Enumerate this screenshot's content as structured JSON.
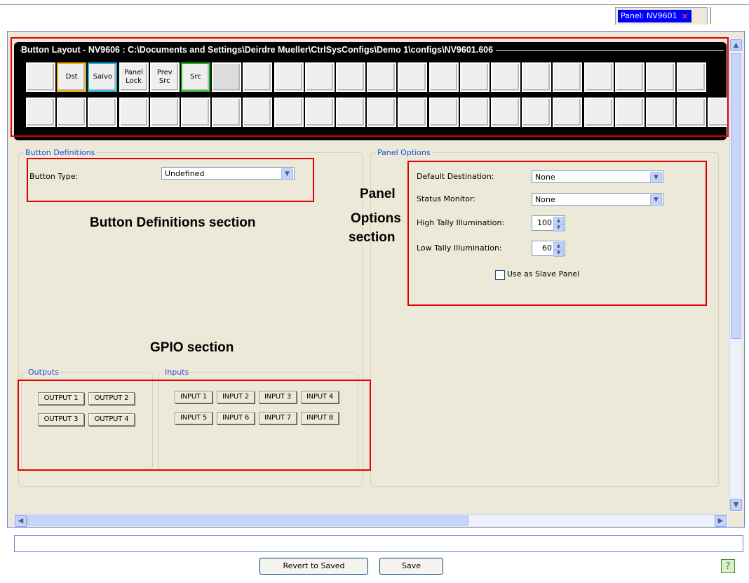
{
  "tab": {
    "label": "Panel: NV9601",
    "close": "×"
  },
  "button_layout": {
    "title": "Button Layout - NV9606 : C:\\Documents and Settings\\Deirdre Mueller\\CtrlSysConfigs\\Demo 1\\configs\\NV9601.606",
    "row1": [
      "",
      "Dst",
      "Salvo",
      "Panel\nLock",
      "Prev\nSrc",
      "Src",
      "",
      "",
      "",
      "",
      "",
      "",
      "",
      "",
      "",
      "",
      "",
      "",
      "",
      "",
      "",
      ""
    ],
    "row2": [
      "",
      "",
      "",
      "",
      "",
      "",
      "",
      "",
      "",
      "",
      "",
      "",
      "",
      "",
      "",
      "",
      "",
      "",
      "",
      "",
      "",
      "",
      ""
    ],
    "colors": {
      "dst": "#f2b400",
      "salvo": "#11b5d6",
      "src": "#18b418"
    }
  },
  "button_definitions": {
    "legend": "Button Definitions",
    "button_type_label": "Button Type:",
    "button_type_value": "Undefined"
  },
  "panel_options": {
    "legend": "Panel Options",
    "default_destination_label": "Default Destination:",
    "default_destination_value": "None",
    "status_monitor_label": "Status Monitor:",
    "status_monitor_value": "None",
    "high_tally_label": "High Tally Illumination:",
    "high_tally_value": "100",
    "low_tally_label": "Low Tally Illumination:",
    "low_tally_value": "60",
    "slave_label": "Use as Slave Panel"
  },
  "outputs": {
    "legend": "Outputs",
    "items": [
      "OUTPUT 1",
      "OUTPUT 2",
      "OUTPUT 3",
      "OUTPUT 4"
    ]
  },
  "inputs": {
    "legend": "Inputs",
    "items": [
      "INPUT 1",
      "INPUT 2",
      "INPUT 3",
      "INPUT 4",
      "INPUT 5",
      "INPUT 6",
      "INPUT 7",
      "INPUT 8"
    ]
  },
  "annotations": {
    "button_definitions": "Button Definitions section",
    "panel_options_1": "Panel",
    "panel_options_2": "Options",
    "panel_options_3": "section",
    "gpio": "GPIO section"
  },
  "footer": {
    "revert_label": "Revert to Saved",
    "save_label": "Save",
    "help": "?"
  },
  "accent_colors": {
    "highlight_red": "#e00000",
    "tab_blue": "#0000ff",
    "legend_blue": "#1d4fd6"
  }
}
